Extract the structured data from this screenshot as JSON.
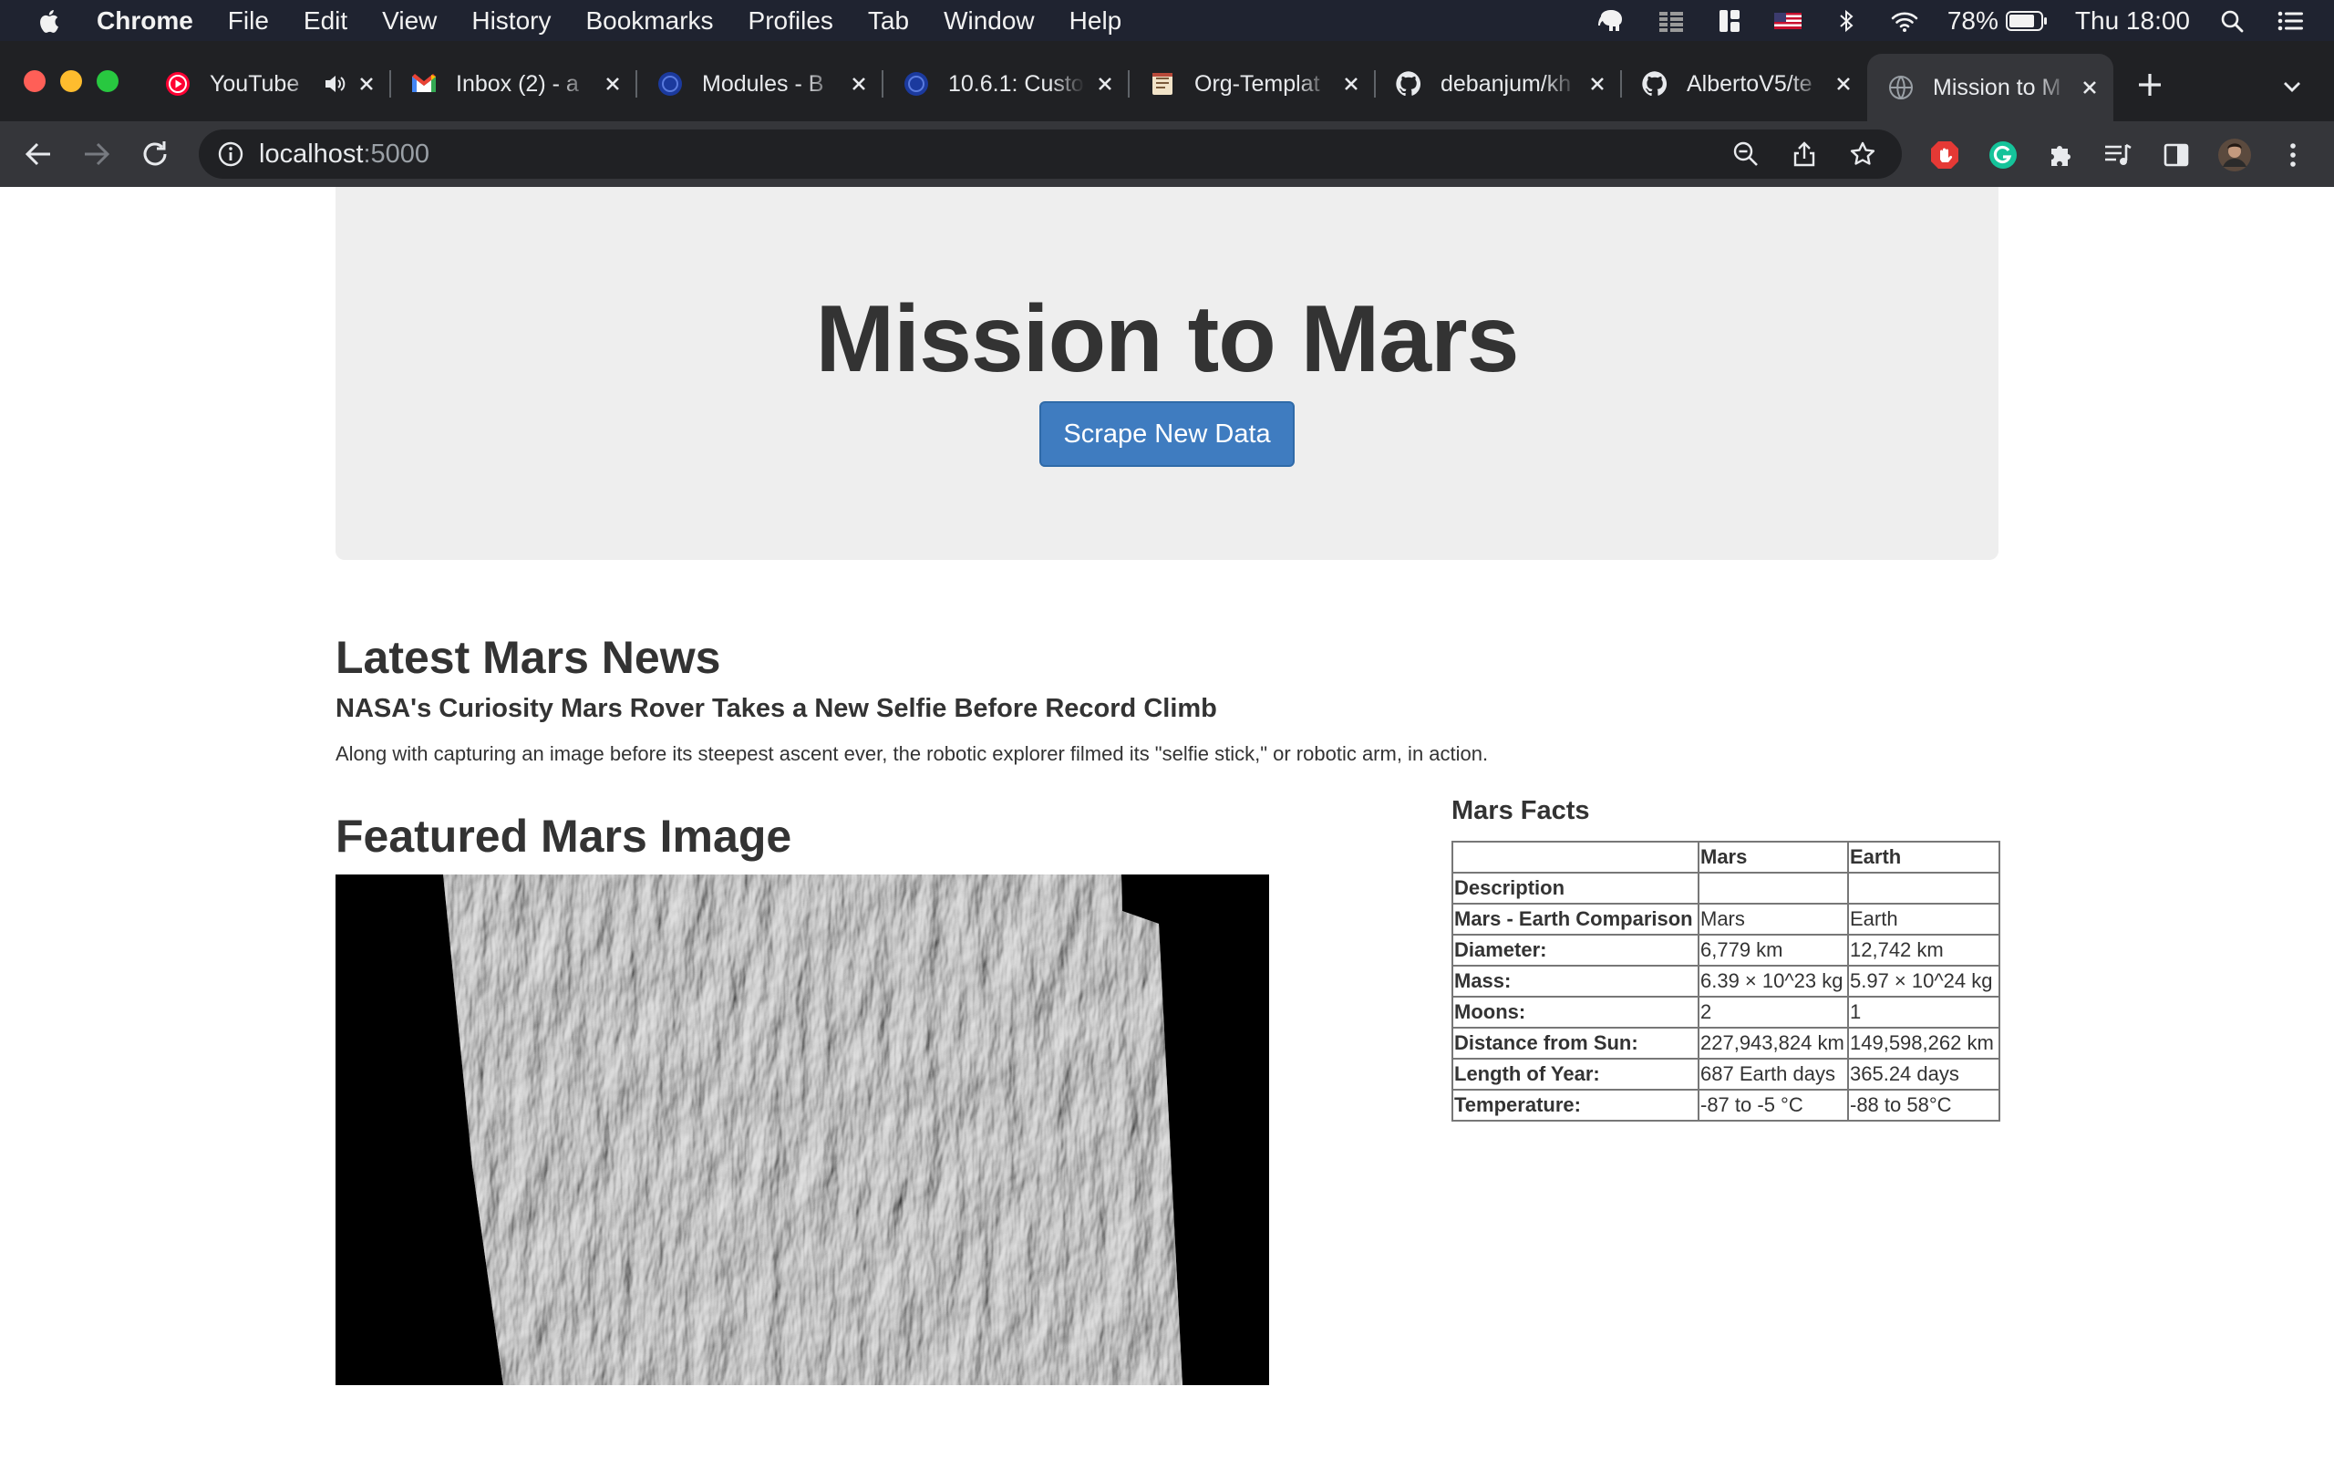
{
  "menubar": {
    "app_name": "Chrome",
    "items": [
      "File",
      "Edit",
      "View",
      "History",
      "Bookmarks",
      "Profiles",
      "Tab",
      "Window",
      "Help"
    ],
    "battery": "78%",
    "clock": "Thu 18:00"
  },
  "tabs": [
    {
      "title": "YouTube",
      "icon": "youtube-icon",
      "audio": true
    },
    {
      "title": "Inbox (2) - a",
      "icon": "gmail-icon"
    },
    {
      "title": "Modules - B",
      "icon": "bootcamp-icon"
    },
    {
      "title": "10.6.1: Custo",
      "icon": "bootcamp-icon"
    },
    {
      "title": "Org-Templat",
      "icon": "document-icon"
    },
    {
      "title": "debanjum/kh",
      "icon": "github-icon"
    },
    {
      "title": "AlbertoV5/te",
      "icon": "github-icon"
    },
    {
      "title": "Mission to M",
      "icon": "globe-icon",
      "active": true
    }
  ],
  "address": {
    "host": "localhost",
    "port": ":5000"
  },
  "hero": {
    "title": "Mission to Mars",
    "button": "Scrape New Data"
  },
  "news": {
    "heading": "Latest Mars News",
    "title": "NASA's Curiosity Mars Rover Takes a New Selfie Before Record Climb",
    "paragraph": "Along with capturing an image before its steepest ascent ever, the robotic explorer filmed its \"selfie stick,\" or robotic arm, in action."
  },
  "featured": {
    "heading": "Featured Mars Image"
  },
  "facts": {
    "heading": "Mars Facts",
    "header": [
      "",
      "Mars",
      "Earth"
    ],
    "rows": [
      [
        "Description",
        "",
        ""
      ],
      [
        "Mars - Earth Comparison",
        "Mars",
        "Earth"
      ],
      [
        "Diameter:",
        "6,779 km",
        "12,742 km"
      ],
      [
        "Mass:",
        "6.39 × 10^23 kg",
        "5.97 × 10^24 kg"
      ],
      [
        "Moons:",
        "2",
        "1"
      ],
      [
        "Distance from Sun:",
        "227,943,824 km",
        "149,598,262 km"
      ],
      [
        "Length of Year:",
        "687 Earth days",
        "365.24 days"
      ],
      [
        "Temperature:",
        "-87 to -5 °C",
        "-88 to 58°C"
      ]
    ]
  }
}
